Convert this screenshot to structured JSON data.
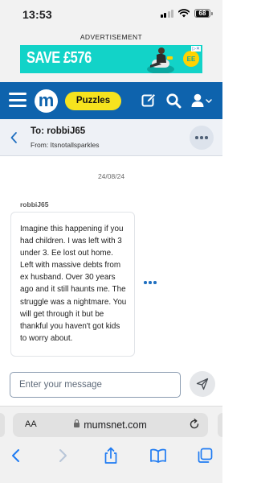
{
  "status_bar": {
    "time": "13:53",
    "battery": "68"
  },
  "ad": {
    "label": "ADVERTISEMENT",
    "text": "SAVE £576",
    "brand_mark": "EE"
  },
  "nav": {
    "puzzles_label": "Puzzles",
    "logo_letter": "m"
  },
  "conversation": {
    "to": "To: robbiJ65",
    "from": "From: Itsnotallsparkles"
  },
  "thread": {
    "date": "24/08/24",
    "sender": "robbiJ65",
    "message": "Imagine this happening if you had children. I was left with 3 under 3. Ee lost out home. Left with massive debts from ex husband. Over 30 years ago and it still haunts me. The struggle was a nightmare. You will get through it but be thankful you haven't got kids to worry about."
  },
  "compose": {
    "placeholder": "Enter your message"
  },
  "browser": {
    "aa_label": "AA",
    "url": "mumsnet.com"
  },
  "colors": {
    "brand_blue": "#0e63ad",
    "puzzles_yellow": "#f6e31e",
    "ad_teal": "#12d3c8",
    "link_blue": "#1f6fc0"
  },
  "icons": [
    "hamburger-icon",
    "pencil-icon",
    "search-icon",
    "user-icon",
    "chevron-down-icon",
    "back-chevron-icon",
    "more-icon",
    "send-icon",
    "lock-icon",
    "reload-icon",
    "back-arrow-icon",
    "forward-arrow-icon",
    "share-icon",
    "bookmarks-icon",
    "tabs-icon"
  ]
}
